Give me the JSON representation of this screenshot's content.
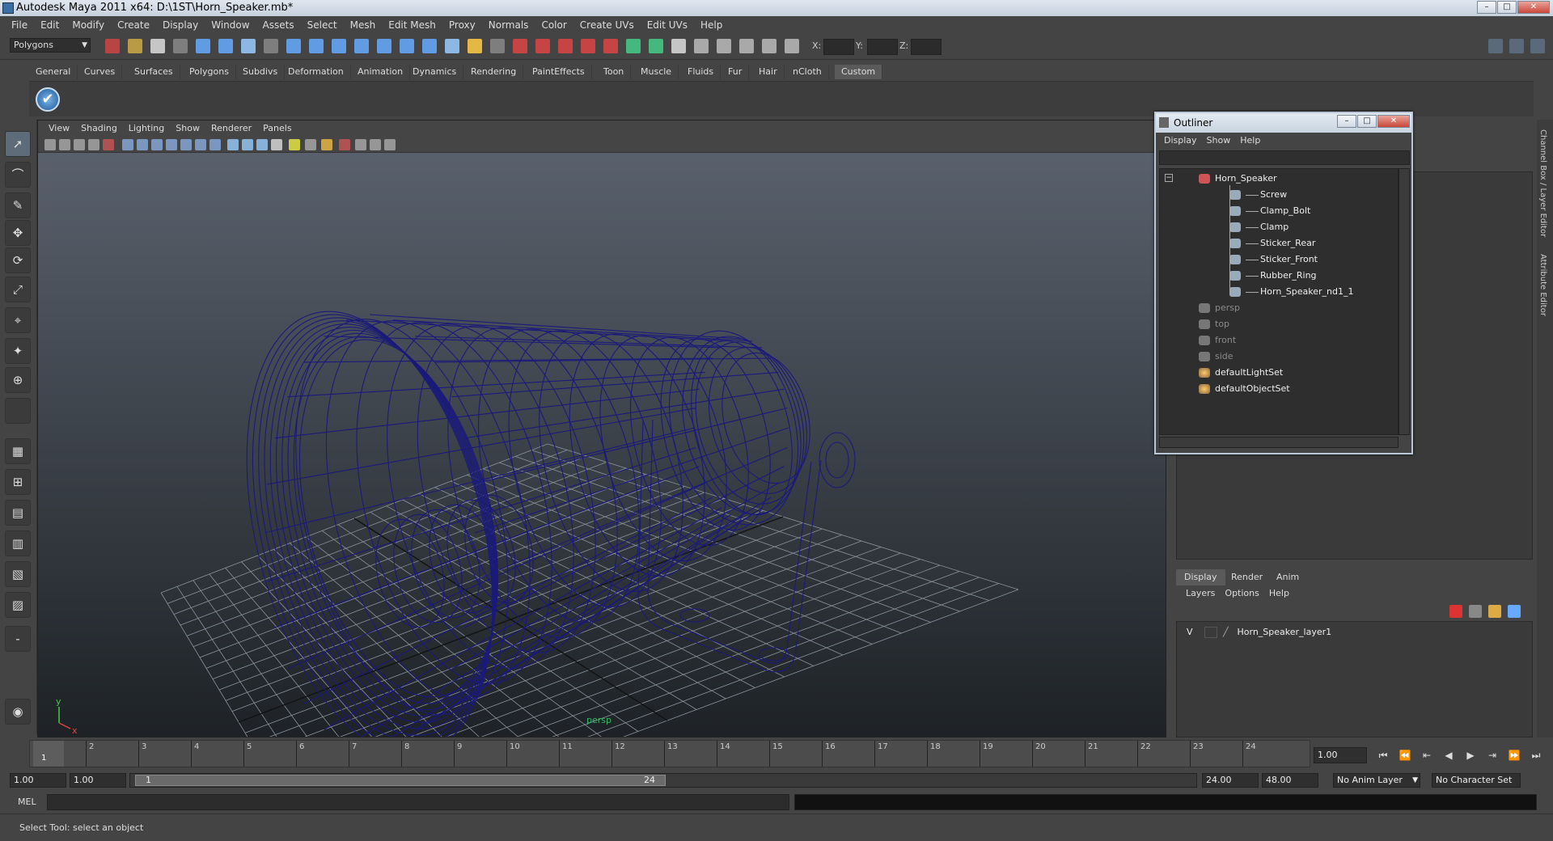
{
  "window": {
    "title": "Autodesk Maya 2011 x64: D:\\1ST\\Horn_Speaker.mb*",
    "minimize": "–",
    "maximize": "□",
    "close": "✕"
  },
  "menubar": [
    "File",
    "Edit",
    "Modify",
    "Create",
    "Display",
    "Window",
    "Assets",
    "Select",
    "Mesh",
    "Edit Mesh",
    "Proxy",
    "Normals",
    "Color",
    "Create UVs",
    "Edit UVs",
    "Help"
  ],
  "statusline": {
    "mode": "Polygons",
    "x_label": "X:",
    "y_label": "Y:",
    "z_label": "Z:"
  },
  "shelf": {
    "tabs": [
      "General",
      "Curves",
      "Surfaces",
      "Polygons",
      "Subdivs",
      "Deformation",
      "Animation",
      "Dynamics",
      "Rendering",
      "PaintEffects",
      "Toon",
      "Muscle",
      "Fluids",
      "Fur",
      "Hair",
      "nCloth",
      "Custom"
    ],
    "active_tab": "Custom",
    "icon": "checkmark-icon"
  },
  "viewport": {
    "menu": [
      "View",
      "Shading",
      "Lighting",
      "Show",
      "Renderer",
      "Panels"
    ],
    "camera_name": "persp",
    "axis_y": "y",
    "axis_x": "x",
    "wire_color": "#1a1a7a"
  },
  "outliner": {
    "title": "Outliner",
    "menu": [
      "Display",
      "Show",
      "Help"
    ],
    "items": [
      {
        "label": "Horn_Speaker",
        "dim": false,
        "depth": 0,
        "icon": "group-icon"
      },
      {
        "label": "Screw",
        "dim": false,
        "depth": 1,
        "icon": "mesh-icon"
      },
      {
        "label": "Clamp_Bolt",
        "dim": false,
        "depth": 1,
        "icon": "mesh-icon"
      },
      {
        "label": "Clamp",
        "dim": false,
        "depth": 1,
        "icon": "mesh-icon"
      },
      {
        "label": "Sticker_Rear",
        "dim": false,
        "depth": 1,
        "icon": "mesh-icon"
      },
      {
        "label": "Sticker_Front",
        "dim": false,
        "depth": 1,
        "icon": "mesh-icon"
      },
      {
        "label": "Rubber_Ring",
        "dim": false,
        "depth": 1,
        "icon": "mesh-icon"
      },
      {
        "label": "Horn_Speaker_nd1_1",
        "dim": false,
        "depth": 1,
        "icon": "mesh-icon"
      },
      {
        "label": "persp",
        "dim": true,
        "depth": 0,
        "icon": "camera-icon"
      },
      {
        "label": "top",
        "dim": true,
        "depth": 0,
        "icon": "camera-icon"
      },
      {
        "label": "front",
        "dim": true,
        "depth": 0,
        "icon": "camera-icon"
      },
      {
        "label": "side",
        "dim": true,
        "depth": 0,
        "icon": "camera-icon"
      },
      {
        "label": "defaultLightSet",
        "dim": false,
        "depth": 0,
        "icon": "set-icon"
      },
      {
        "label": "defaultObjectSet",
        "dim": false,
        "depth": 0,
        "icon": "set-icon"
      }
    ]
  },
  "sidebar_labels": [
    "Channel Box / Layer Editor",
    "Attribute Editor"
  ],
  "layer_editor": {
    "tabs": [
      "Display",
      "Render",
      "Anim"
    ],
    "active_tab": "Display",
    "menu": [
      "Layers",
      "Options",
      "Help"
    ],
    "layer": {
      "visible": "V",
      "name": "Horn_Speaker_layer1"
    }
  },
  "timeslider": {
    "ticks": [
      "1",
      "2",
      "3",
      "4",
      "5",
      "6",
      "7",
      "8",
      "9",
      "10",
      "11",
      "12",
      "13",
      "14",
      "15",
      "16",
      "17",
      "18",
      "19",
      "20",
      "21",
      "22",
      "23",
      "24"
    ],
    "current_marker": "1",
    "current_frame": "1.00",
    "playback": [
      "⏮",
      "⏪",
      "⇤",
      "◀",
      "▶",
      "⇥",
      "⏩",
      "⏭"
    ]
  },
  "rangeslider": {
    "start": "1.00",
    "playback_start": "1.00",
    "range_start_label": "1",
    "range_end_label": "24",
    "playback_end": "24.00",
    "end": "48.00",
    "anim_layer": "No Anim Layer",
    "character_set": "No Character Set"
  },
  "cmdline": {
    "label": "MEL"
  },
  "helpline": {
    "text": "Select Tool: select an object"
  }
}
